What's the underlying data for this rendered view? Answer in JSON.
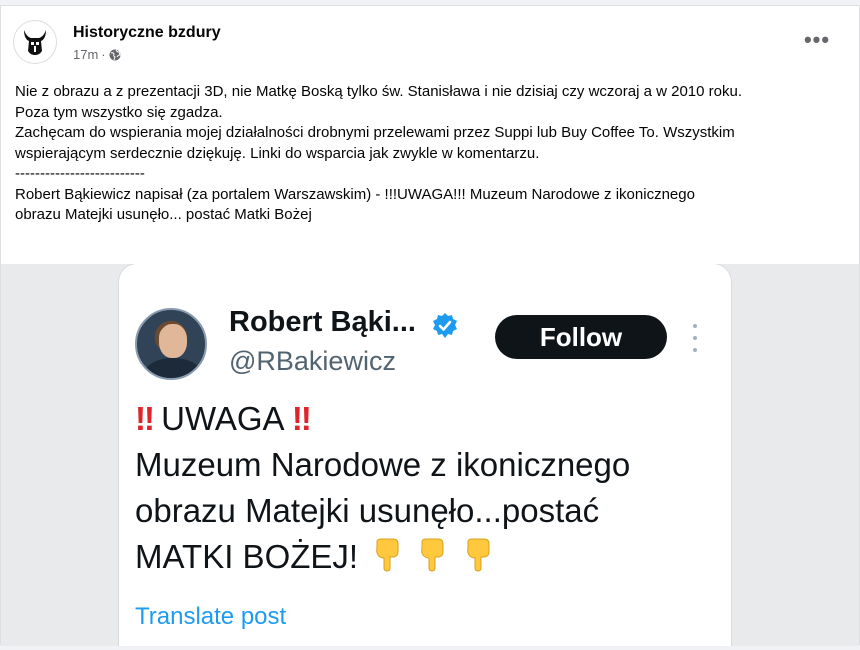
{
  "post": {
    "page_name": "Historyczne bzdury",
    "time": "17m",
    "dot": "·",
    "more": "•••",
    "text_lines": [
      "Nie z obrazu a z prezentacji 3D, nie Matkę Boską tylko św. Stanisława i nie dzisiaj czy wczoraj a w 2010 roku.",
      "Poza tym wszystko się zgadza.",
      "Zachęcam do wspierania mojej działalności drobnymi przelewami przez Suppi lub Buy Coffee To. Wszystkim",
      "wspierającym serdecznie dziękuję. Linki do wsparcia jak zwykle w komentarzu.",
      "--------------------------",
      "Robert Bąkiewicz napisał (za portalem Warszawskim) - !!!UWAGA!!! Muzeum Narodowe z ikonicznego",
      "obrazu Matejki usunęło... postać Matki Bożej"
    ]
  },
  "tweet": {
    "name": "Robert Bąki...",
    "handle": "@RBakiewicz",
    "follow_label": "Follow",
    "bang": "‼",
    "headline": " UWAGA ",
    "line2": "Muzeum Narodowe z ikonicznego",
    "line3": "obrazu Matejki usunęło...postać",
    "line4": "MATKI BOŻEJ!",
    "translate_label": "Translate post"
  },
  "colors": {
    "verified": "#1d9bf0",
    "follow_bg": "#0f1419",
    "bang": "#e0242c",
    "link": "#1d9bf0",
    "emoji": "#ffc83d"
  },
  "icons": {
    "avatar": "horned-helmet-logo",
    "globe": "globe-icon",
    "verified": "verified-badge-icon",
    "hands": [
      "pointing-down-hand-emoji",
      "pointing-down-hand-emoji",
      "pointing-down-hand-emoji"
    ]
  }
}
